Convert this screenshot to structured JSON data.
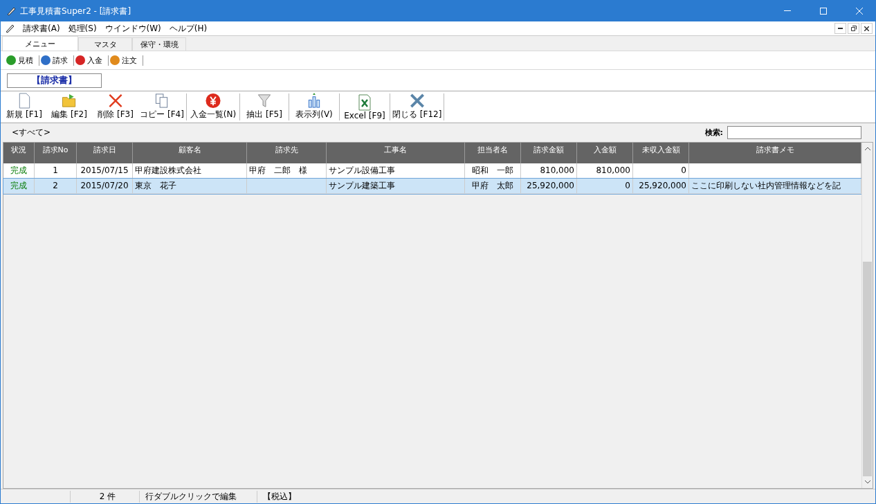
{
  "window": {
    "title": "工事見積書Super2 - [請求書]"
  },
  "menu": [
    "請求書(A)",
    "処理(S)",
    "ウインドウ(W)",
    "ヘルプ(H)"
  ],
  "tabs": [
    {
      "label": "メニュー",
      "selected": true
    },
    {
      "label": "マスタ",
      "selected": false
    },
    {
      "label": "保守・環境",
      "selected": false
    }
  ],
  "quick_links": [
    "見積",
    "請求",
    "入金",
    "注文"
  ],
  "section_title": "【請求書】",
  "toolbar": [
    "新規 [F1]",
    "編集 [F2]",
    "削除 [F3]",
    "コピー [F4]",
    "入金一覧(N)",
    "抽出 [F5]",
    "表示列(V)",
    "Excel [F9]",
    "閉じる [F12]"
  ],
  "filter": {
    "label": "<すべて>",
    "search_label": "検索:"
  },
  "table": {
    "columns": [
      "状況",
      "請求No",
      "請求日",
      "顧客名",
      "請求先",
      "工事名",
      "担当者名",
      "請求金額",
      "入金額",
      "未収入金額",
      "請求書メモ"
    ],
    "rows": [
      {
        "selected": false,
        "cells": [
          "完成",
          "1",
          "2015/07/15",
          "甲府建設株式会社",
          "甲府　二郎　様",
          "サンプル設備工事",
          "昭和　一郎",
          "810,000",
          "810,000",
          "0",
          ""
        ]
      },
      {
        "selected": true,
        "cells": [
          "完成",
          "2",
          "2015/07/20",
          "東京　花子",
          "",
          "サンプル建築工事",
          "甲府　太郎",
          "25,920,000",
          "0",
          "25,920,000",
          "ここに印刷しない社内管理情報などを記"
        ]
      }
    ]
  },
  "status_bar": [
    "2 件",
    "行ダブルクリックで編集",
    "【税込】"
  ]
}
